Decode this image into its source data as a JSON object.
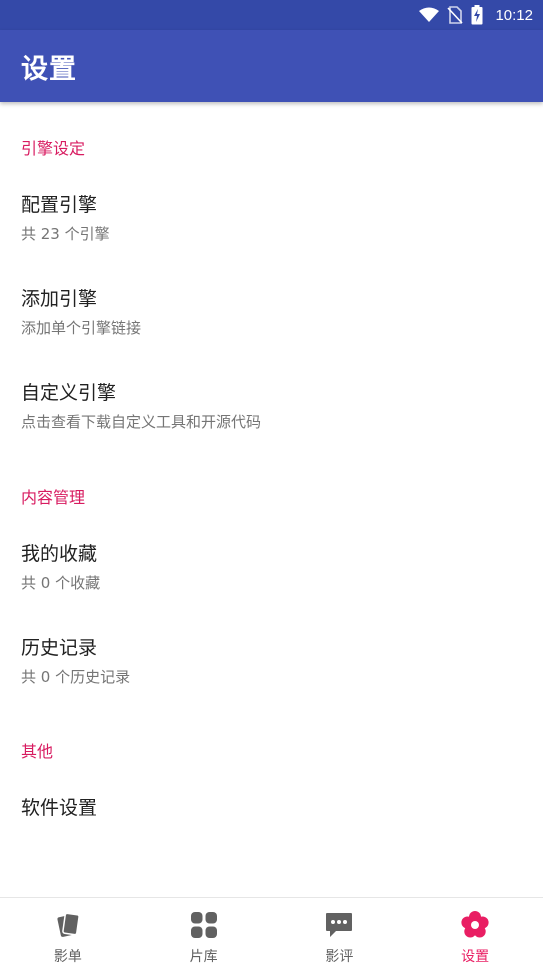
{
  "status_bar": {
    "time": "10:12",
    "icons": [
      "wifi-icon",
      "no-sim-icon",
      "battery-charging-icon"
    ]
  },
  "app_bar": {
    "title": "设置"
  },
  "colors": {
    "primary": "#3f51b5",
    "primary_dark": "#3449a8",
    "accent": "#e91e63",
    "section_header": "#d81b60",
    "inactive_icon": "#616161"
  },
  "sections": {
    "engine": {
      "header": "引擎设定",
      "items": [
        {
          "title": "配置引擎",
          "summary": "共 23 个引擎"
        },
        {
          "title": "添加引擎",
          "summary": "添加单个引擎链接"
        },
        {
          "title": "自定义引擎",
          "summary": "点击查看下载自定义工具和开源代码"
        }
      ]
    },
    "content": {
      "header": "内容管理",
      "items": [
        {
          "title": "我的收藏",
          "summary": "共 0 个收藏"
        },
        {
          "title": "历史记录",
          "summary": "共 0 个历史记录"
        }
      ]
    },
    "other": {
      "header": "其他",
      "items": [
        {
          "title": "软件设置"
        }
      ]
    }
  },
  "bottom_nav": {
    "items": [
      {
        "label": "影单",
        "icon": "cards-icon",
        "active": false
      },
      {
        "label": "片库",
        "icon": "grid-icon",
        "active": false
      },
      {
        "label": "影评",
        "icon": "comment-icon",
        "active": false
      },
      {
        "label": "设置",
        "icon": "flower-icon",
        "active": true
      }
    ]
  }
}
